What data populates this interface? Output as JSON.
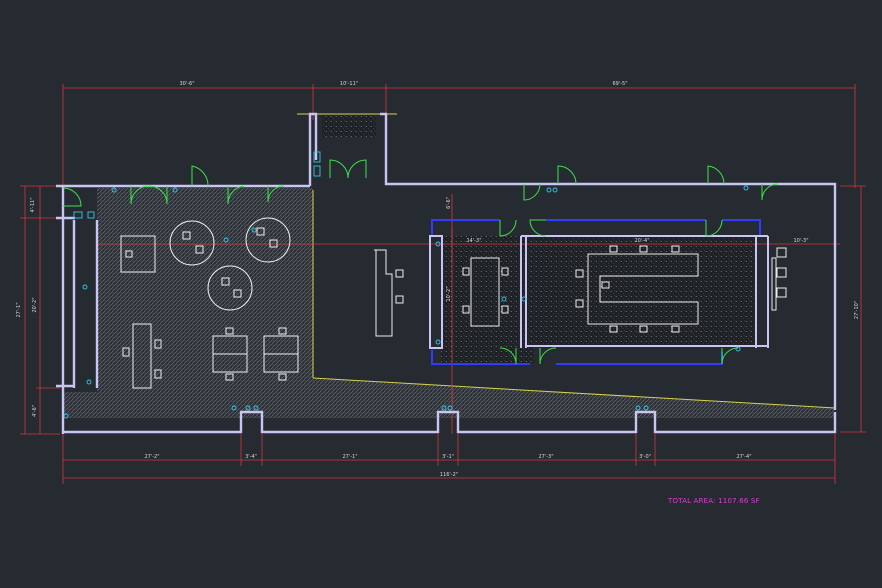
{
  "dimensions": {
    "top": [
      "30'-6\"",
      "10'-11\"",
      "69'-5\""
    ],
    "bottom_segments": [
      "27'-2\"",
      "3'-4\"",
      "27'-1\"",
      "3'-1\"",
      "27'-3\"",
      "3'-0\"",
      "27'-4\""
    ],
    "bottom_total": "116'-2\"",
    "left_small": "4'-11\"",
    "left_total": "27'-1\"",
    "left_mid": "20'-2\"",
    "left_bottom": "4'-6\"",
    "right_total": "27'-10\"",
    "interior_left": "14'-3\"",
    "interior_room": "20'-4\"",
    "interior_right": "10'-3\"",
    "interior_vertical": "6'-6\"",
    "interior_vertical_2": "10'-2\""
  },
  "total_area_label": "TOTAL AREA: 1107.66 SF",
  "colors": {
    "background": "#262b32",
    "walls": "#c9c4f2",
    "dimensions": "#d9363e",
    "doors": "#3ee04a",
    "furniture": "#ececec",
    "enclosures": "#2f3cff",
    "total_area": "#e23bd6",
    "fixtures": "#37c5e6"
  }
}
